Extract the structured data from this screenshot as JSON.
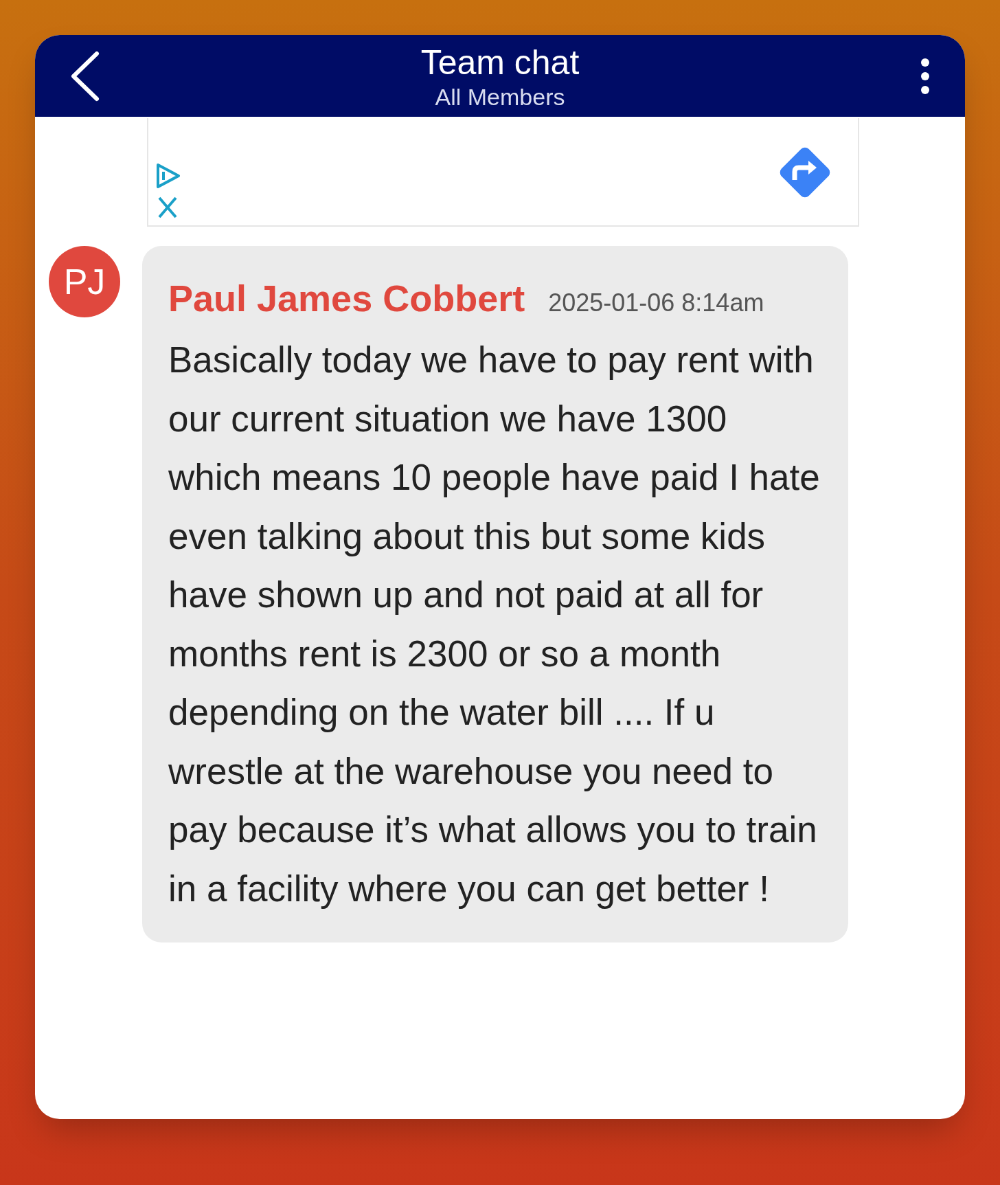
{
  "header": {
    "title": "Team chat",
    "subtitle": "All Members"
  },
  "message": {
    "initials": "PJ",
    "author": "Paul James Cobbert",
    "time": "2025-01-06 8:14am",
    "text": "Basically today we have to pay rent with our current situation we have 1300 which means 10 people have paid I hate even talking about this but some kids have shown up and not paid at all for months rent is 2300 or so a month depending on the water bill .... If u wrestle at the warehouse you need to pay because it’s what allows you to train in a facility where you can get better !"
  }
}
